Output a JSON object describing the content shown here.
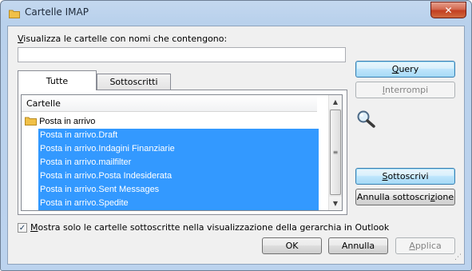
{
  "window": {
    "title": "Cartelle IMAP",
    "close_symbol": "✕"
  },
  "filter": {
    "label_accel": "V",
    "label_rest": "isualizza le cartelle con nomi che contengono:",
    "value": "",
    "placeholder": ""
  },
  "tabs": [
    {
      "label": "Tutte",
      "active": true
    },
    {
      "label": "Sottoscritti",
      "active": false
    }
  ],
  "list": {
    "header": "Cartelle",
    "root": "Posta in arrivo",
    "items": [
      "Posta in arrivo.Draft",
      "Posta in arrivo.Indagini Finanziarie",
      "Posta in arrivo.mailfilter",
      "Posta in arrivo.Posta Indesiderata",
      "Posta in arrivo.Sent Messages",
      "Posta in arrivo.Spedite"
    ],
    "scroll_up": "▲",
    "scroll_down": "▼",
    "thumb_grip": "≡"
  },
  "buttons": {
    "query": {
      "accel": "Q",
      "rest": "uery"
    },
    "interrompi": {
      "accel": "I",
      "rest": "nterrompi"
    },
    "sottoscrivi": {
      "accel": "S",
      "rest": "ottoscrivi"
    },
    "annulla_sottoscrizione": {
      "pre": "Annulla sottoscri",
      "accel": "z",
      "post": "ione"
    },
    "ok": "OK",
    "annulla": "Annulla",
    "applica": {
      "accel": "A",
      "rest": "pplica"
    }
  },
  "option": {
    "checked": true,
    "check_symbol": "✓",
    "label_accel": "M",
    "label_rest": "ostra solo le cartelle sottoscritte nella visualizzazione della gerarchia in Outlook"
  },
  "colors": {
    "selection": "#3399ff",
    "folder": "#f0c048",
    "title_bar": "#bcd3ee"
  }
}
